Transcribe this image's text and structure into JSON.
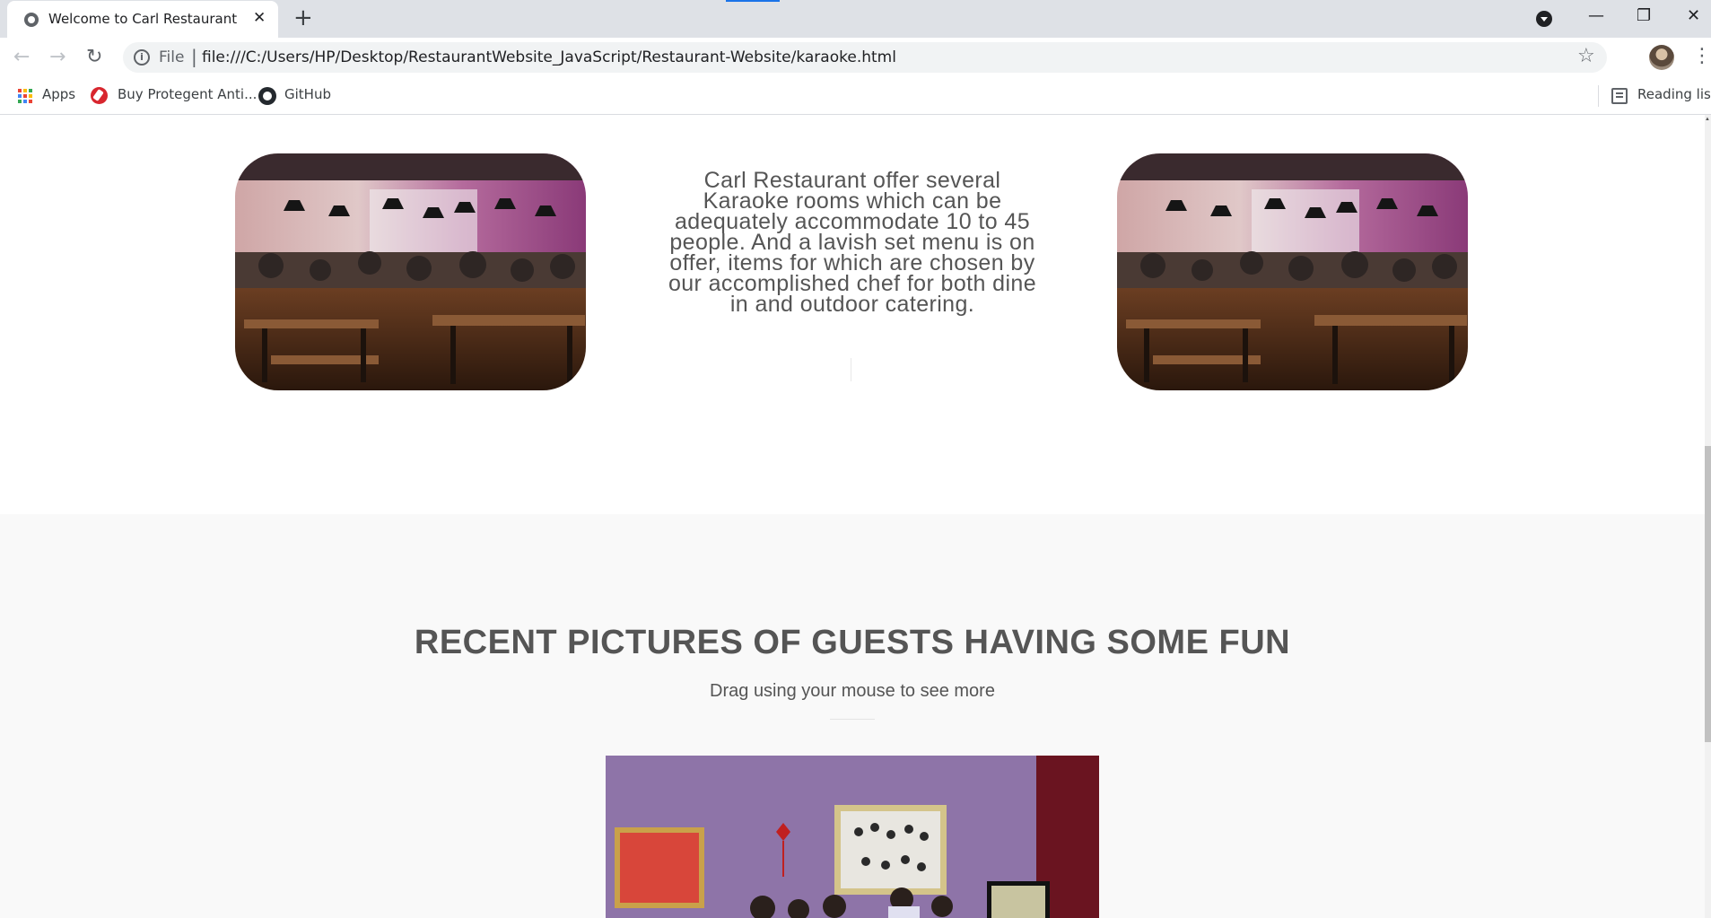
{
  "browser": {
    "tab_title": "Welcome to Carl Restaurant",
    "tab_close": "✕",
    "new_tab": "+",
    "url_scheme": "File",
    "url": "file:///C:/Users/HP/Desktop/RestaurantWebsite_JavaScript/Restaurant-Website/karaoke.html",
    "back": "←",
    "forward": "→",
    "reload": "↻",
    "minimize": "—",
    "maximize": "❐",
    "close": "✕",
    "star": "☆",
    "menu": "⋮",
    "info": "i"
  },
  "bookmarks": {
    "items": [
      {
        "label": "Apps",
        "icon": "apps-grid-icon"
      },
      {
        "label": "Buy Protegent Anti...",
        "icon": "protegent-icon"
      },
      {
        "label": "GitHub",
        "icon": "github-icon"
      }
    ],
    "reading_list": "Reading list"
  },
  "page": {
    "karaoke_description": "Carl Restaurant offer several Karaoke rooms which can be adequately accommodate 10 to 45 people. And a lavish set menu is on offer, items for which are chosen by our accomplished chef for both dine in and outdoor catering.",
    "gallery": {
      "title": "RECENT PICTURES OF GUESTS HAVING SOME FUN",
      "subtitle": "Drag using your mouse to see more"
    }
  },
  "colors": {
    "tabstrip": "#dee1e6",
    "accent": "#1a73e8",
    "text_gray": "#555555",
    "section_bg": "#f9f9f9"
  }
}
